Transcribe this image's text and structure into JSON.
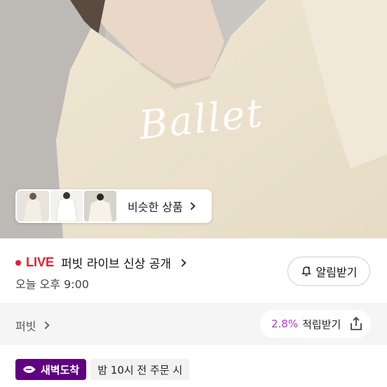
{
  "hero": {
    "script_text": "Ballet"
  },
  "similar": {
    "label": "비슷한 상품"
  },
  "live": {
    "tag": "LIVE",
    "title": "퍼빗 라이브 신상 공개",
    "time": "오늘 오후 9:00",
    "alarm_label": "알림받기"
  },
  "brand": {
    "name": "퍼빗"
  },
  "reward": {
    "percent": "2.8%",
    "label": "적립받기"
  },
  "delivery": {
    "badge": "새벽도착",
    "cutoff": "밤 10시 전 주문 시"
  },
  "colors": {
    "live_red": "#ed1b2f",
    "kurly_purple": "#5f0080",
    "reward_purple": "#b53bd1"
  }
}
